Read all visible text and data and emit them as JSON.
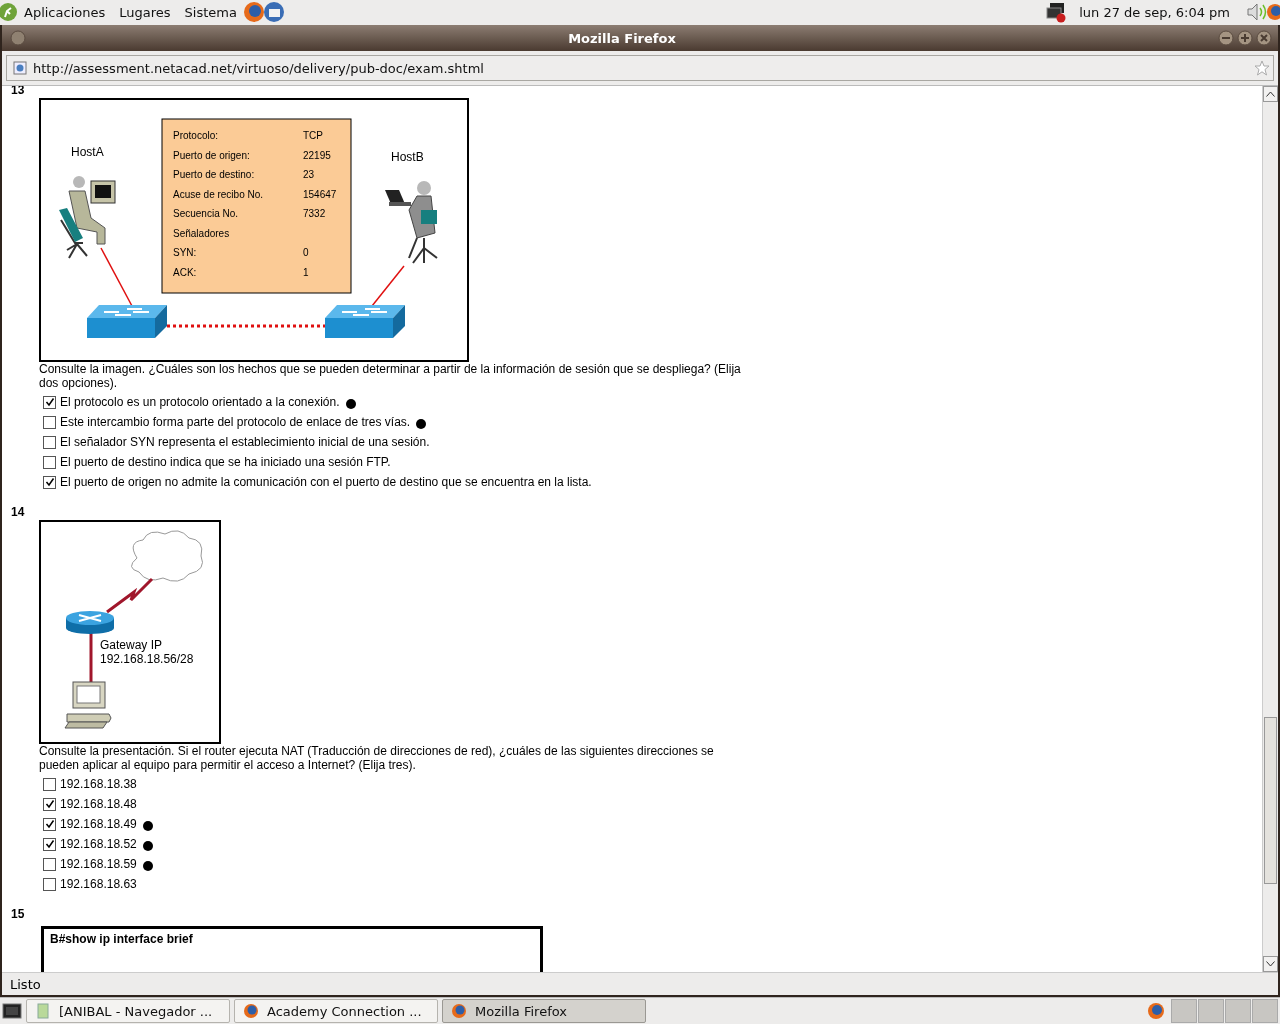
{
  "panel": {
    "menus": [
      "Aplicaciones",
      "Lugares",
      "Sistema"
    ],
    "clock": "lun 27 de sep,  6:04 pm"
  },
  "window": {
    "title": "Mozilla Firefox",
    "url": "http://assessment.netacad.net/virtuoso/delivery/pub-doc/exam.shtml",
    "status": "Listo"
  },
  "questions": [
    {
      "number": "13",
      "kind": "session",
      "exhibit": {
        "host_a": "HostA",
        "host_b": "HostB",
        "fields": [
          {
            "label": "Protocolo:",
            "value": "TCP"
          },
          {
            "label": "Puerto de origen:",
            "value": "22195"
          },
          {
            "label": "Puerto de destino:",
            "value": "23"
          },
          {
            "label": "Acuse de recibo No.",
            "value": "154647"
          },
          {
            "label": "Secuencia No.",
            "value": "7332"
          },
          {
            "label": "Señaladores"
          },
          {
            "label": "SYN:",
            "value": "0"
          },
          {
            "label": "ACK:",
            "value": "1"
          }
        ]
      },
      "prompt": "Consulte la imagen. ¿Cuáles son los hechos que se pueden determinar a partir de la información de sesión que se despliega? (Elija dos opciones).",
      "options": [
        {
          "text": "El protocolo es un protocolo orientado a la conexión.",
          "checked": true,
          "marked": true
        },
        {
          "text": "Este intercambio forma parte del protocolo de enlace de tres vías.",
          "checked": false,
          "marked": true
        },
        {
          "text": "El señalador SYN representa el establecimiento inicial de una sesión.",
          "checked": false,
          "marked": false
        },
        {
          "text": "El puerto de destino indica que se ha iniciado una sesión FTP.",
          "checked": false,
          "marked": false
        },
        {
          "text": "El puerto de origen no admite la comunicación con el puerto de destino que se encuentra en la lista.",
          "checked": true,
          "marked": false
        }
      ]
    },
    {
      "number": "14",
      "kind": "nat",
      "exhibit": {
        "gateway_label": "Gateway IP",
        "gateway_address": "192.168.18.56/28"
      },
      "prompt": "Consulte la presentación. Si el router ejecuta NAT (Traducción de direcciones de red), ¿cuáles de las siguientes direcciones se pueden aplicar al equipo para permitir el acceso a Internet? (Elija tres).",
      "options": [
        {
          "text": "192.168.18.38",
          "checked": false,
          "marked": false
        },
        {
          "text": "192.168.18.48",
          "checked": true,
          "marked": false
        },
        {
          "text": "192.168.18.49",
          "checked": true,
          "marked": true
        },
        {
          "text": "192.168.18.52",
          "checked": true,
          "marked": true
        },
        {
          "text": "192.168.18.59",
          "checked": false,
          "marked": true
        },
        {
          "text": "192.168.18.63",
          "checked": false,
          "marked": false
        }
      ]
    },
    {
      "number": "15",
      "kind": "console",
      "exhibit": {
        "command": "B#show ip interface brief"
      }
    }
  ],
  "taskbar": [
    {
      "label": "[ANIBAL - Navegador ...",
      "kind": "folder",
      "selected": false
    },
    {
      "label": "Academy Connection ...",
      "kind": "browser",
      "selected": false
    },
    {
      "label": "Mozilla Firefox",
      "kind": "browser",
      "selected": true
    }
  ]
}
